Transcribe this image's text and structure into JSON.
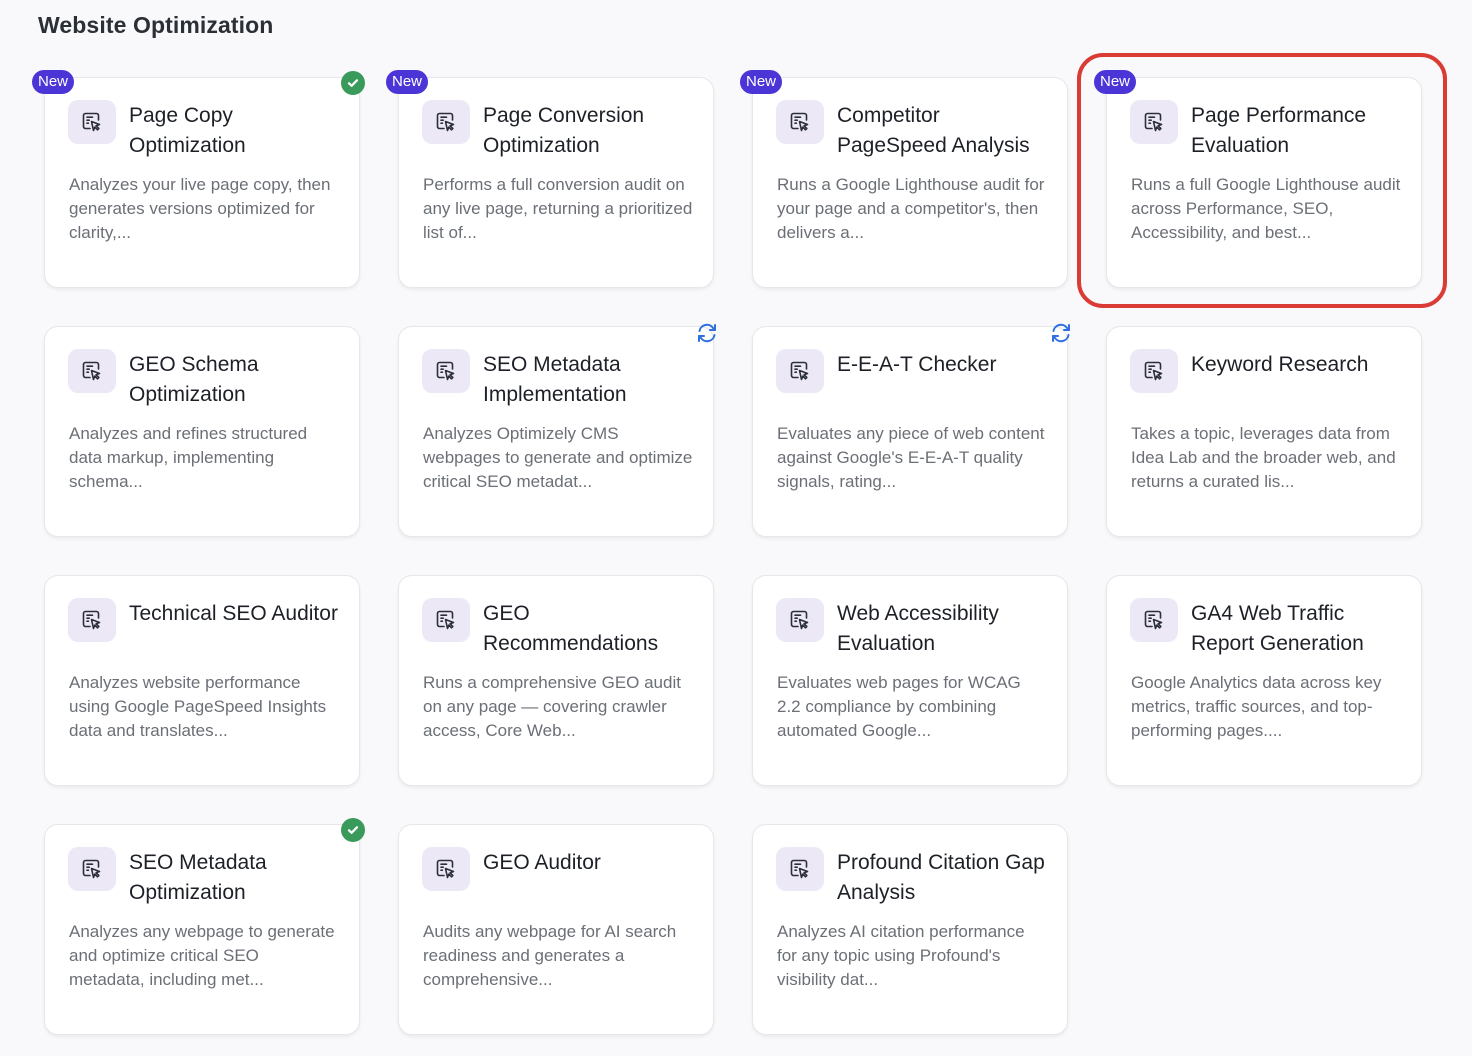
{
  "section": {
    "title": "Website Optimization"
  },
  "badges": {
    "new_label": "New"
  },
  "colors": {
    "accent_badge": "#4b35d6",
    "success": "#3a9a5c",
    "sync": "#2f6fe0",
    "highlight": "#db3b35",
    "icon_bg": "#ece8f6"
  },
  "cards": [
    {
      "title": "Page Copy Optimization",
      "description": "Analyzes your live page copy, then generates versions optimized for clarity,...",
      "is_new": true,
      "status": "check",
      "icon": "cursor-click-icon"
    },
    {
      "title": "Page Conversion Optimization",
      "description": "Performs a full conversion audit on any live page, returning a prioritized list of...",
      "is_new": true,
      "status": "",
      "icon": "cursor-click-icon"
    },
    {
      "title": "Competitor PageSpeed Analysis",
      "description": "Runs a Google Lighthouse audit for your page and a competitor's, then delivers a...",
      "is_new": true,
      "status": "",
      "icon": "cursor-click-icon"
    },
    {
      "title": "Page Performance Evaluation",
      "description": "Runs a full Google Lighthouse audit across Performance, SEO, Accessibility, and best...",
      "is_new": true,
      "status": "",
      "icon": "cursor-click-icon",
      "highlighted": true
    },
    {
      "title": "GEO Schema Optimization",
      "description": "Analyzes and refines structured data markup, implementing schema...",
      "is_new": false,
      "status": "",
      "icon": "cursor-click-icon"
    },
    {
      "title": "SEO Metadata Implementation",
      "description": "Analyzes Optimizely CMS webpages to generate and optimize critical SEO metadat...",
      "is_new": false,
      "status": "sync",
      "icon": "cursor-click-icon"
    },
    {
      "title": "E-E-A-T Checker",
      "description": "Evaluates any piece of web content against Google's E-E-A-T quality signals, rating...",
      "is_new": false,
      "status": "sync",
      "icon": "cursor-click-icon"
    },
    {
      "title": "Keyword Research",
      "description": "Takes a topic, leverages data from Idea Lab and the broader web, and returns a curated lis...",
      "is_new": false,
      "status": "",
      "icon": "cursor-click-icon"
    },
    {
      "title": "Technical SEO Auditor",
      "description": "Analyzes website performance using Google PageSpeed Insights data and translates...",
      "is_new": false,
      "status": "",
      "icon": "cursor-click-icon"
    },
    {
      "title": "GEO Recommendations",
      "description": "Runs a comprehensive GEO audit on any page — covering crawler access, Core Web...",
      "is_new": false,
      "status": "",
      "icon": "cursor-click-icon"
    },
    {
      "title": "Web Accessibility Evaluation",
      "description": "Evaluates web pages for WCAG 2.2 compliance by combining automated Google...",
      "is_new": false,
      "status": "",
      "icon": "cursor-click-icon"
    },
    {
      "title": "GA4 Web Traffic Report Generation",
      "description": "Google Analytics data across key metrics, traffic sources, and top-performing pages....",
      "is_new": false,
      "status": "",
      "icon": "cursor-click-icon"
    },
    {
      "title": "SEO Metadata Optimization",
      "description": "Analyzes any webpage to generate and optimize critical SEO metadata, including met...",
      "is_new": false,
      "status": "check",
      "icon": "cursor-click-icon"
    },
    {
      "title": "GEO Auditor",
      "description": "Audits any webpage for AI search readiness and generates a comprehensive...",
      "is_new": false,
      "status": "",
      "icon": "cursor-click-icon"
    },
    {
      "title": "Profound Citation Gap Analysis",
      "description": "Analyzes AI citation performance for any topic using Profound's visibility dat...",
      "is_new": false,
      "status": "",
      "icon": "cursor-click-icon"
    }
  ]
}
